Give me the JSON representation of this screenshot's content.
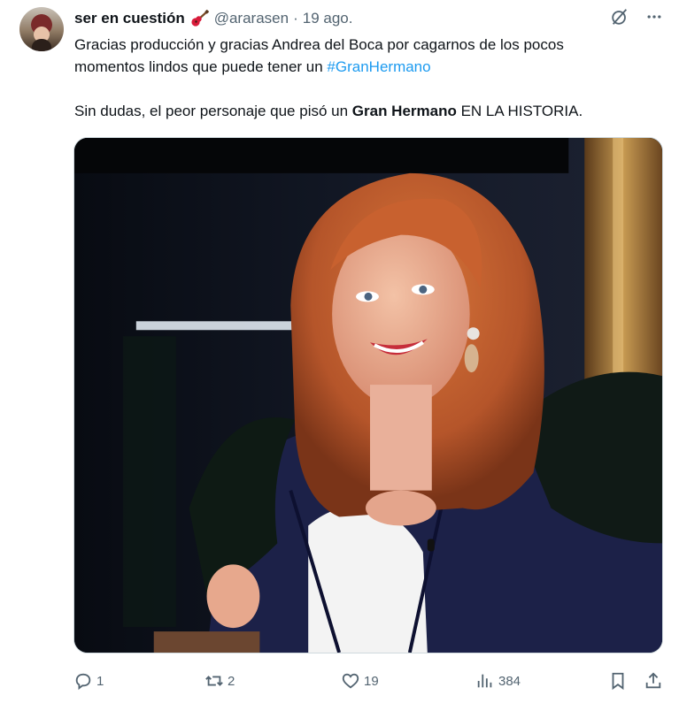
{
  "tweet": {
    "author_name": "ser en cuestión",
    "handle": "@ararasen",
    "separator": "·",
    "time": "19 ago.",
    "line1": "Gracias producción y gracias Andrea del Boca por cagarnos de los pocos",
    "line2_prefix": "momentos lindos que puede tener un ",
    "hashtag": "#GranHermano",
    "line3_prefix": "Sin dudas, el peor personaje que pisó un ",
    "line3_bold": "Gran Hermano",
    "line3_suffix": " EN LA HISTORIA."
  },
  "media": {
    "description_icon": "photo-of-red-haired-woman-smiling"
  },
  "actions": {
    "replies": "1",
    "retweets": "2",
    "likes": "19",
    "views": "384"
  },
  "colors": {
    "link": "#1d9bf0",
    "secondary_text": "#536471",
    "primary_text": "#0f1419"
  }
}
